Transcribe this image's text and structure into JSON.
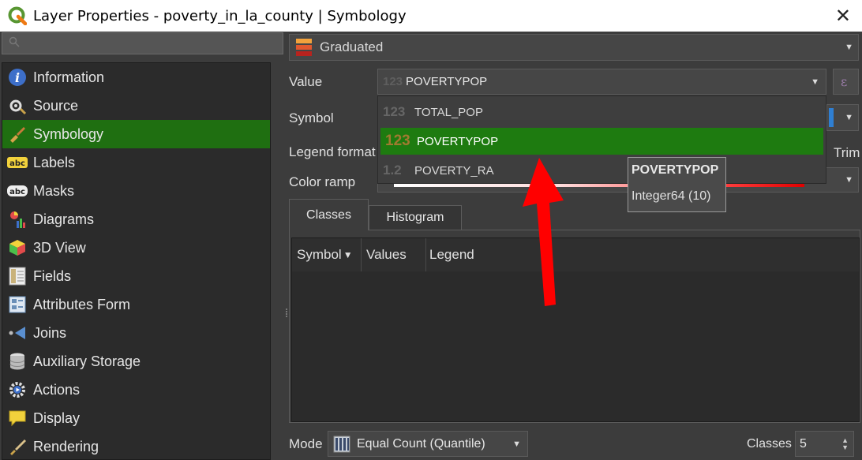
{
  "window": {
    "title": "Layer Properties - poverty_in_la_county | Symbology",
    "close_glyph": "✕"
  },
  "sidebar": {
    "items": [
      {
        "label": "Information",
        "icon": "info-icon"
      },
      {
        "label": "Source",
        "icon": "source-icon"
      },
      {
        "label": "Symbology",
        "icon": "symbology-brush-icon",
        "selected": true
      },
      {
        "label": "Labels",
        "icon": "labels-abc-icon"
      },
      {
        "label": "Masks",
        "icon": "masks-abc-icon"
      },
      {
        "label": "Diagrams",
        "icon": "diagrams-icon"
      },
      {
        "label": "3D View",
        "icon": "cube-icon"
      },
      {
        "label": "Fields",
        "icon": "fields-icon"
      },
      {
        "label": "Attributes Form",
        "icon": "form-icon"
      },
      {
        "label": "Joins",
        "icon": "joins-icon"
      },
      {
        "label": "Auxiliary Storage",
        "icon": "database-icon"
      },
      {
        "label": "Actions",
        "icon": "gear-play-icon"
      },
      {
        "label": "Display",
        "icon": "speech-bubble-icon"
      },
      {
        "label": "Rendering",
        "icon": "brush-icon"
      }
    ]
  },
  "renderer": {
    "type": "Graduated"
  },
  "form": {
    "value_label": "Value",
    "value_selected": "POVERTYPOP",
    "value_type_glyph": "123",
    "symbol_label": "Symbol",
    "legend_format_label": "Legend format",
    "trim_label": "Trim",
    "color_ramp_label": "Color ramp"
  },
  "dropdown": {
    "options": [
      {
        "glyph": "123",
        "label": "TOTAL_POP"
      },
      {
        "glyph": "123",
        "label": "POVERTYPOP",
        "selected": true
      },
      {
        "glyph": "1.2",
        "label": "POVERTY_RA"
      }
    ]
  },
  "tooltip": {
    "title": "POVERTYPOP",
    "type": "Integer64 (10)"
  },
  "tabs": [
    {
      "label": "Classes",
      "active": true
    },
    {
      "label": "Histogram",
      "active": false
    }
  ],
  "table": {
    "columns": [
      "Symbol",
      "Values",
      "Legend"
    ],
    "sort_glyph": "▼"
  },
  "bottom": {
    "mode_label": "Mode",
    "mode_value": "Equal Count (Quantile)",
    "classes_label": "Classes",
    "classes_value": "5"
  },
  "colors": {
    "selection_green": "#1f6f11",
    "annotation_arrow": "#ff0000"
  }
}
